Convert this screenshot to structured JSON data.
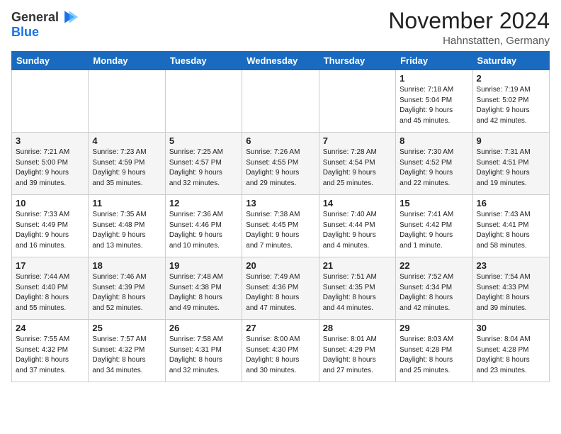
{
  "logo": {
    "general": "General",
    "blue": "Blue"
  },
  "title": {
    "month_year": "November 2024",
    "location": "Hahnstatten, Germany"
  },
  "weekdays": [
    "Sunday",
    "Monday",
    "Tuesday",
    "Wednesday",
    "Thursday",
    "Friday",
    "Saturday"
  ],
  "weeks": [
    [
      {
        "day": "",
        "info": ""
      },
      {
        "day": "",
        "info": ""
      },
      {
        "day": "",
        "info": ""
      },
      {
        "day": "",
        "info": ""
      },
      {
        "day": "",
        "info": ""
      },
      {
        "day": "1",
        "info": "Sunrise: 7:18 AM\nSunset: 5:04 PM\nDaylight: 9 hours\nand 45 minutes."
      },
      {
        "day": "2",
        "info": "Sunrise: 7:19 AM\nSunset: 5:02 PM\nDaylight: 9 hours\nand 42 minutes."
      }
    ],
    [
      {
        "day": "3",
        "info": "Sunrise: 7:21 AM\nSunset: 5:00 PM\nDaylight: 9 hours\nand 39 minutes."
      },
      {
        "day": "4",
        "info": "Sunrise: 7:23 AM\nSunset: 4:59 PM\nDaylight: 9 hours\nand 35 minutes."
      },
      {
        "day": "5",
        "info": "Sunrise: 7:25 AM\nSunset: 4:57 PM\nDaylight: 9 hours\nand 32 minutes."
      },
      {
        "day": "6",
        "info": "Sunrise: 7:26 AM\nSunset: 4:55 PM\nDaylight: 9 hours\nand 29 minutes."
      },
      {
        "day": "7",
        "info": "Sunrise: 7:28 AM\nSunset: 4:54 PM\nDaylight: 9 hours\nand 25 minutes."
      },
      {
        "day": "8",
        "info": "Sunrise: 7:30 AM\nSunset: 4:52 PM\nDaylight: 9 hours\nand 22 minutes."
      },
      {
        "day": "9",
        "info": "Sunrise: 7:31 AM\nSunset: 4:51 PM\nDaylight: 9 hours\nand 19 minutes."
      }
    ],
    [
      {
        "day": "10",
        "info": "Sunrise: 7:33 AM\nSunset: 4:49 PM\nDaylight: 9 hours\nand 16 minutes."
      },
      {
        "day": "11",
        "info": "Sunrise: 7:35 AM\nSunset: 4:48 PM\nDaylight: 9 hours\nand 13 minutes."
      },
      {
        "day": "12",
        "info": "Sunrise: 7:36 AM\nSunset: 4:46 PM\nDaylight: 9 hours\nand 10 minutes."
      },
      {
        "day": "13",
        "info": "Sunrise: 7:38 AM\nSunset: 4:45 PM\nDaylight: 9 hours\nand 7 minutes."
      },
      {
        "day": "14",
        "info": "Sunrise: 7:40 AM\nSunset: 4:44 PM\nDaylight: 9 hours\nand 4 minutes."
      },
      {
        "day": "15",
        "info": "Sunrise: 7:41 AM\nSunset: 4:42 PM\nDaylight: 9 hours\nand 1 minute."
      },
      {
        "day": "16",
        "info": "Sunrise: 7:43 AM\nSunset: 4:41 PM\nDaylight: 8 hours\nand 58 minutes."
      }
    ],
    [
      {
        "day": "17",
        "info": "Sunrise: 7:44 AM\nSunset: 4:40 PM\nDaylight: 8 hours\nand 55 minutes."
      },
      {
        "day": "18",
        "info": "Sunrise: 7:46 AM\nSunset: 4:39 PM\nDaylight: 8 hours\nand 52 minutes."
      },
      {
        "day": "19",
        "info": "Sunrise: 7:48 AM\nSunset: 4:38 PM\nDaylight: 8 hours\nand 49 minutes."
      },
      {
        "day": "20",
        "info": "Sunrise: 7:49 AM\nSunset: 4:36 PM\nDaylight: 8 hours\nand 47 minutes."
      },
      {
        "day": "21",
        "info": "Sunrise: 7:51 AM\nSunset: 4:35 PM\nDaylight: 8 hours\nand 44 minutes."
      },
      {
        "day": "22",
        "info": "Sunrise: 7:52 AM\nSunset: 4:34 PM\nDaylight: 8 hours\nand 42 minutes."
      },
      {
        "day": "23",
        "info": "Sunrise: 7:54 AM\nSunset: 4:33 PM\nDaylight: 8 hours\nand 39 minutes."
      }
    ],
    [
      {
        "day": "24",
        "info": "Sunrise: 7:55 AM\nSunset: 4:32 PM\nDaylight: 8 hours\nand 37 minutes."
      },
      {
        "day": "25",
        "info": "Sunrise: 7:57 AM\nSunset: 4:32 PM\nDaylight: 8 hours\nand 34 minutes."
      },
      {
        "day": "26",
        "info": "Sunrise: 7:58 AM\nSunset: 4:31 PM\nDaylight: 8 hours\nand 32 minutes."
      },
      {
        "day": "27",
        "info": "Sunrise: 8:00 AM\nSunset: 4:30 PM\nDaylight: 8 hours\nand 30 minutes."
      },
      {
        "day": "28",
        "info": "Sunrise: 8:01 AM\nSunset: 4:29 PM\nDaylight: 8 hours\nand 27 minutes."
      },
      {
        "day": "29",
        "info": "Sunrise: 8:03 AM\nSunset: 4:28 PM\nDaylight: 8 hours\nand 25 minutes."
      },
      {
        "day": "30",
        "info": "Sunrise: 8:04 AM\nSunset: 4:28 PM\nDaylight: 8 hours\nand 23 minutes."
      }
    ]
  ]
}
